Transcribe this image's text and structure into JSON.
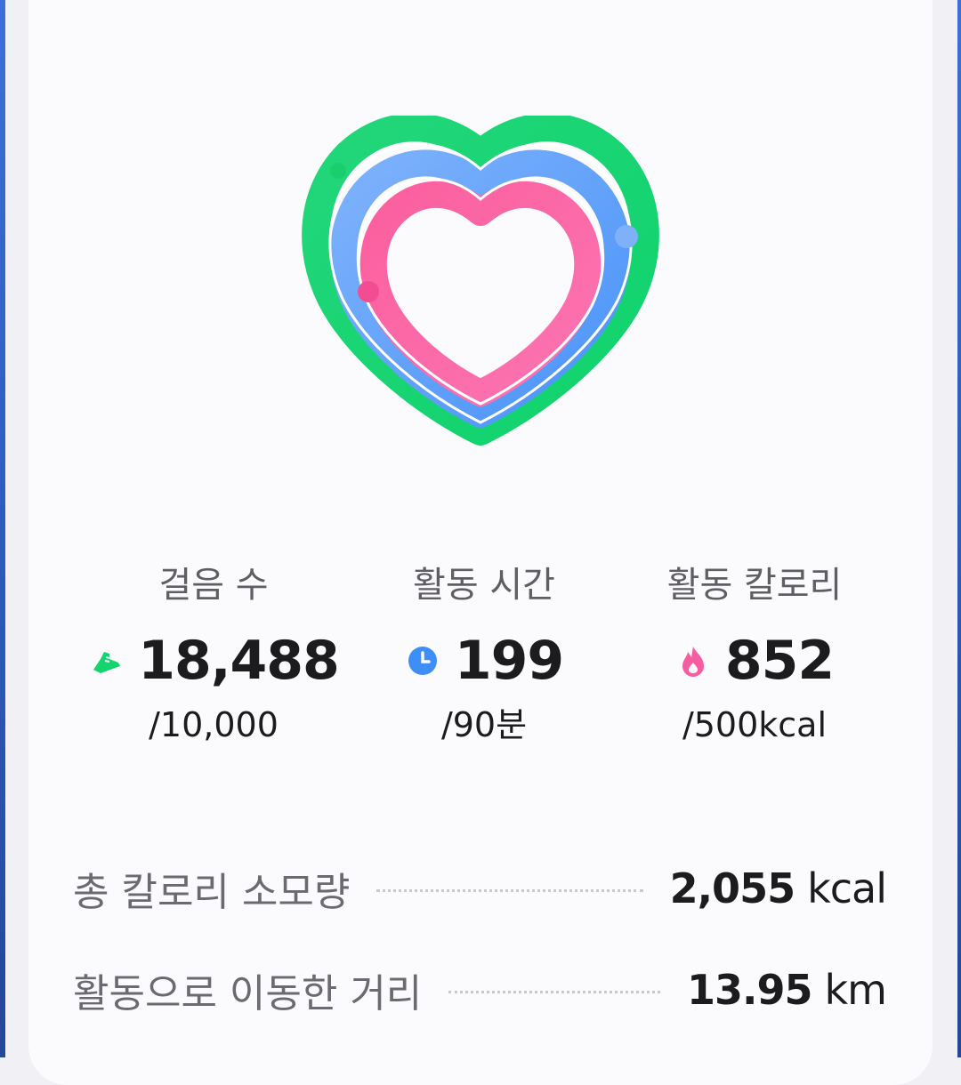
{
  "activity": {
    "rings": {
      "steps_progress": 1.0,
      "active_time_progress": 1.0,
      "calories_progress": 1.0,
      "colors": {
        "steps": "#14d46e",
        "active_time": "#5b9dfb",
        "calories": "#f95da1"
      }
    },
    "stats": [
      {
        "label": "걸음 수",
        "icon": "shoe-icon",
        "icon_color": "#14d46e",
        "value": "18,488",
        "goal": "/10,000"
      },
      {
        "label": "활동 시간",
        "icon": "clock-icon",
        "icon_color": "#3d8ef5",
        "value": "199",
        "goal": "/90분"
      },
      {
        "label": "활동 칼로리",
        "icon": "flame-icon",
        "icon_color": "#f95da1",
        "value": "852",
        "goal": "/500kcal"
      }
    ],
    "summary": [
      {
        "label": "총 칼로리 소모량",
        "value": "2,055",
        "unit": "kcal"
      },
      {
        "label": "활동으로 이동한 거리",
        "value": "13.95",
        "unit": "km"
      }
    ]
  }
}
